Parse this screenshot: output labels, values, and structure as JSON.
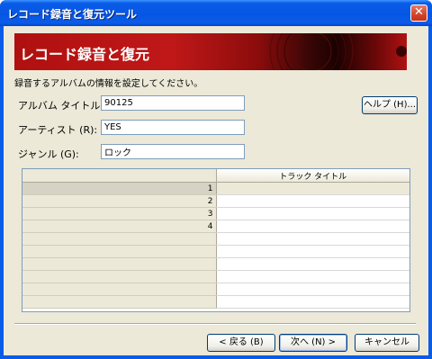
{
  "window": {
    "title": "レコード録音と復元ツール",
    "close_label": "✕"
  },
  "banner": {
    "title": "レコード録音と復元"
  },
  "instruction": "録音するアルバムの情報を設定してください。",
  "form": {
    "album_title_label": "アルバム タイトル (T):",
    "album_title_value": "90125",
    "artist_label": "アーティスト (R):",
    "artist_value": "YES",
    "genre_label": "ジャンル (G):",
    "genre_value": "ロック"
  },
  "help_button": "ヘルプ (H)...",
  "track_table": {
    "column_header": "トラック タイトル",
    "rows": [
      "1",
      "2",
      "3",
      "4",
      "",
      "",
      "",
      "",
      "",
      ""
    ]
  },
  "buttons": {
    "back": "< 戻る (B)",
    "next": "次へ (N) >",
    "cancel": "キャンセル"
  },
  "colors": {
    "title_bar": "#0a5ce8",
    "banner": "#b01010",
    "dialog_bg": "#ece9d8"
  }
}
